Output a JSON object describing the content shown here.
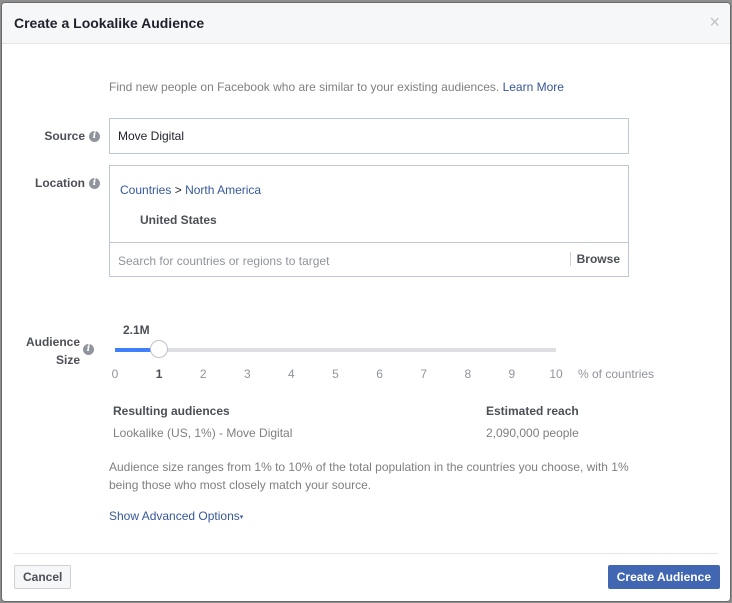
{
  "dialog": {
    "title": "Create a Lookalike Audience",
    "close_icon": "×"
  },
  "intro": {
    "text": "Find new people on Facebook who are similar to your existing audiences.",
    "link": "Learn More"
  },
  "source": {
    "label": "Source",
    "value": "Move Digital"
  },
  "location": {
    "label": "Location",
    "breadcrumb": [
      "Countries",
      "North America"
    ],
    "separator": ">",
    "selected": "United States",
    "search_placeholder": "Search for countries or regions to target",
    "browse_label": "Browse"
  },
  "audience_size": {
    "label_line1": "Audience",
    "label_line2": "Size",
    "value_label": "2.1M",
    "selected_percent": 1,
    "range": [
      0,
      10
    ],
    "ticks": [
      "0",
      "1",
      "2",
      "3",
      "4",
      "5",
      "6",
      "7",
      "8",
      "9",
      "10"
    ],
    "unit": "% of countries",
    "accent_color": "#4080ff"
  },
  "results": {
    "resulting_header": "Resulting audiences",
    "resulting_value": "Lookalike (US, 1%) - Move Digital",
    "reach_header": "Estimated reach",
    "reach_value": "2,090,000 people"
  },
  "note": "Audience size ranges from 1% to 10% of the total population in the countries you choose, with 1% being those who most closely match your source.",
  "advanced_link": "Show Advanced Options",
  "advanced_caret": "▾",
  "footer": {
    "cancel_label": "Cancel",
    "create_label": "Create Audience",
    "create_color": "#4267b2"
  }
}
